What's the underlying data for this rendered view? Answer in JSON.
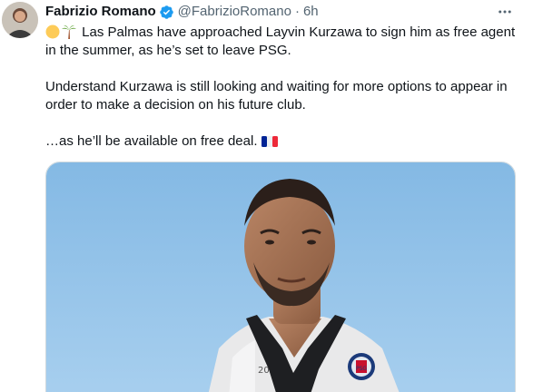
{
  "author": {
    "display_name": "Fabrizio Romano",
    "handle": "@FabrizioRomano",
    "separator": "·",
    "time_ago": "6h",
    "verified_color": "#1d9bf0",
    "avatar_icon": "person-avatar"
  },
  "tweet": {
    "paragraphs": [
      {
        "emojis": [
          "yellow-circle-emoji",
          "palm-tree-emoji"
        ],
        "text": " Las Palmas have approached Layvin Kurzawa to sign him as free agent in the summer, as he’s set to leave PSG."
      },
      {
        "text": "Understand Kurzawa is still looking and waiting for more options to appear in order to make a decision on his future club."
      },
      {
        "text": "…as he’ll be available on free deal. ",
        "emojis_after": [
          "france-flag-emoji"
        ]
      }
    ]
  },
  "media": {
    "description_icon": "photo-player-training",
    "sky_color": "#8fc0e6"
  },
  "actions": {
    "more_icon": "more-horizontal-icon"
  }
}
